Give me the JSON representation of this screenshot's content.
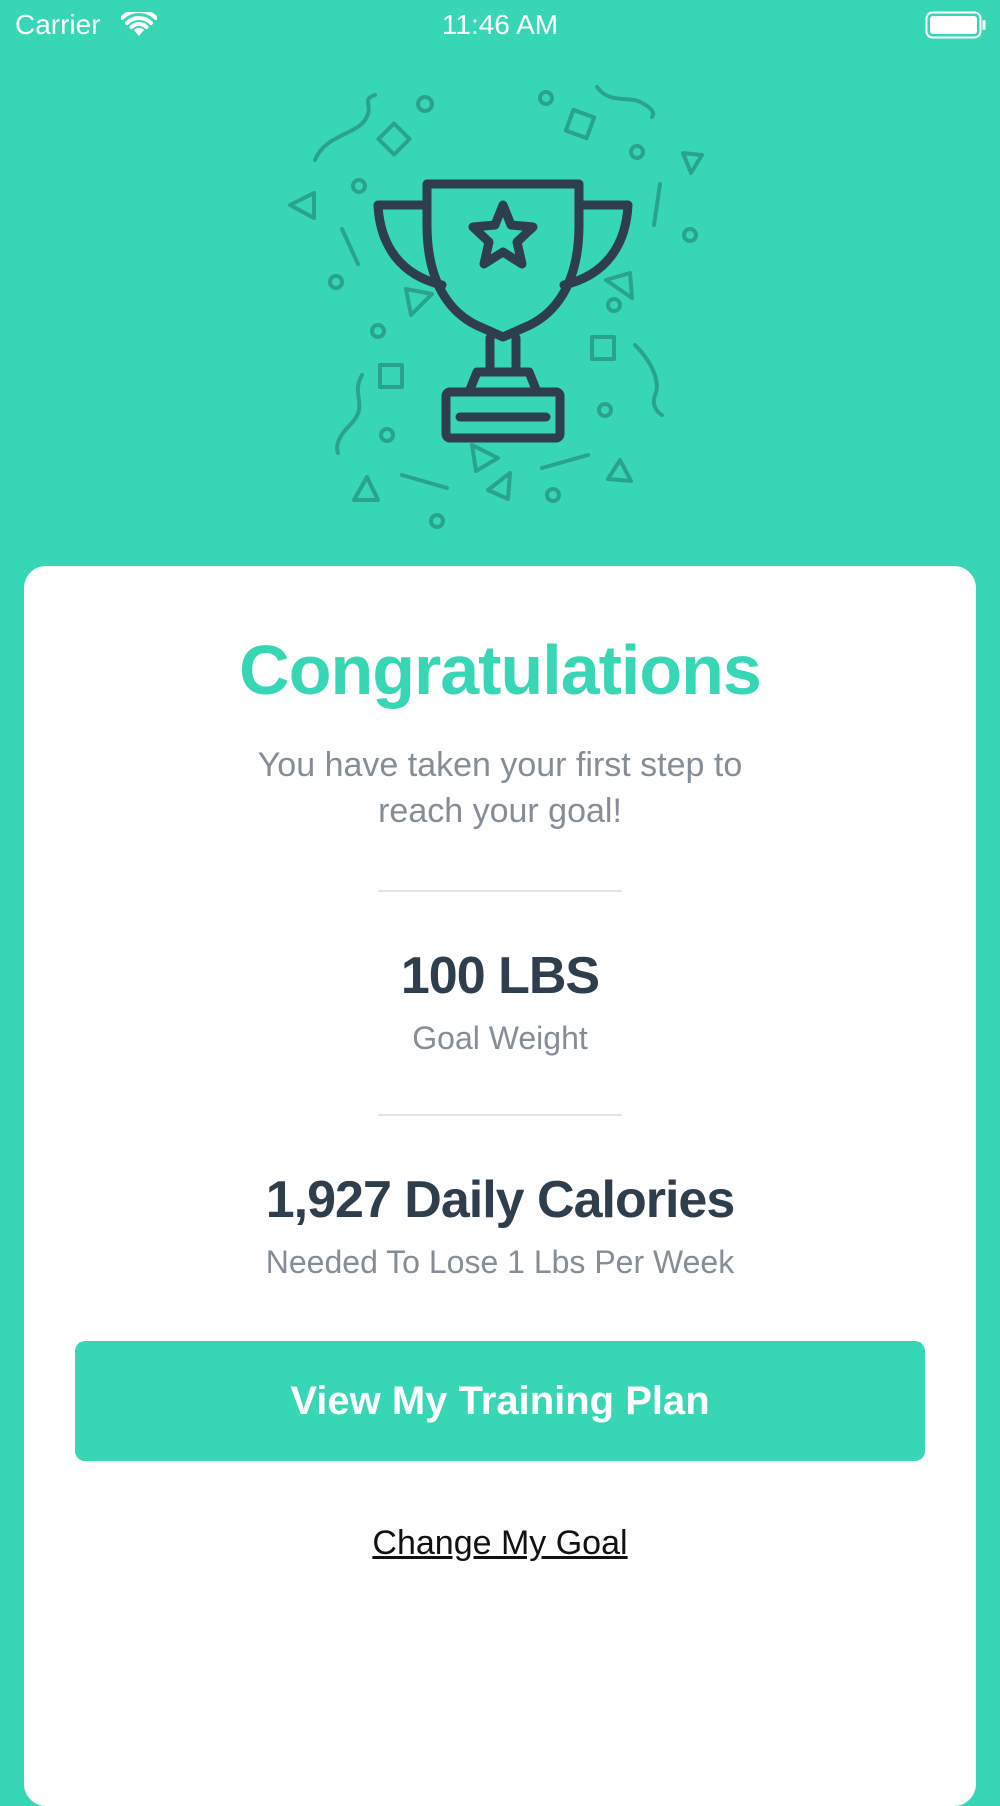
{
  "status_bar": {
    "carrier": "Carrier",
    "time": "11:46 AM",
    "wifi_icon": "wifi-icon",
    "battery_icon": "battery-icon"
  },
  "hero": {
    "icon": "trophy-icon",
    "decoration": "confetti-decoration"
  },
  "card": {
    "title": "Congratulations",
    "subtitle": "You have taken your first step to reach your goal!",
    "goal": {
      "value": "100 LBS",
      "label": "Goal Weight"
    },
    "calories": {
      "value": "1,927 Daily Calories",
      "label": "Needed To Lose 1 Lbs Per Week"
    },
    "primary_button_label": "View My Training Plan",
    "secondary_link_label": "Change My Goal"
  },
  "colors": {
    "accent": "#37d6b5",
    "dark_text": "#2f3e4d",
    "muted_text": "#858d96",
    "trophy": "#2f3e4d",
    "confetti": "#2aa38c"
  }
}
